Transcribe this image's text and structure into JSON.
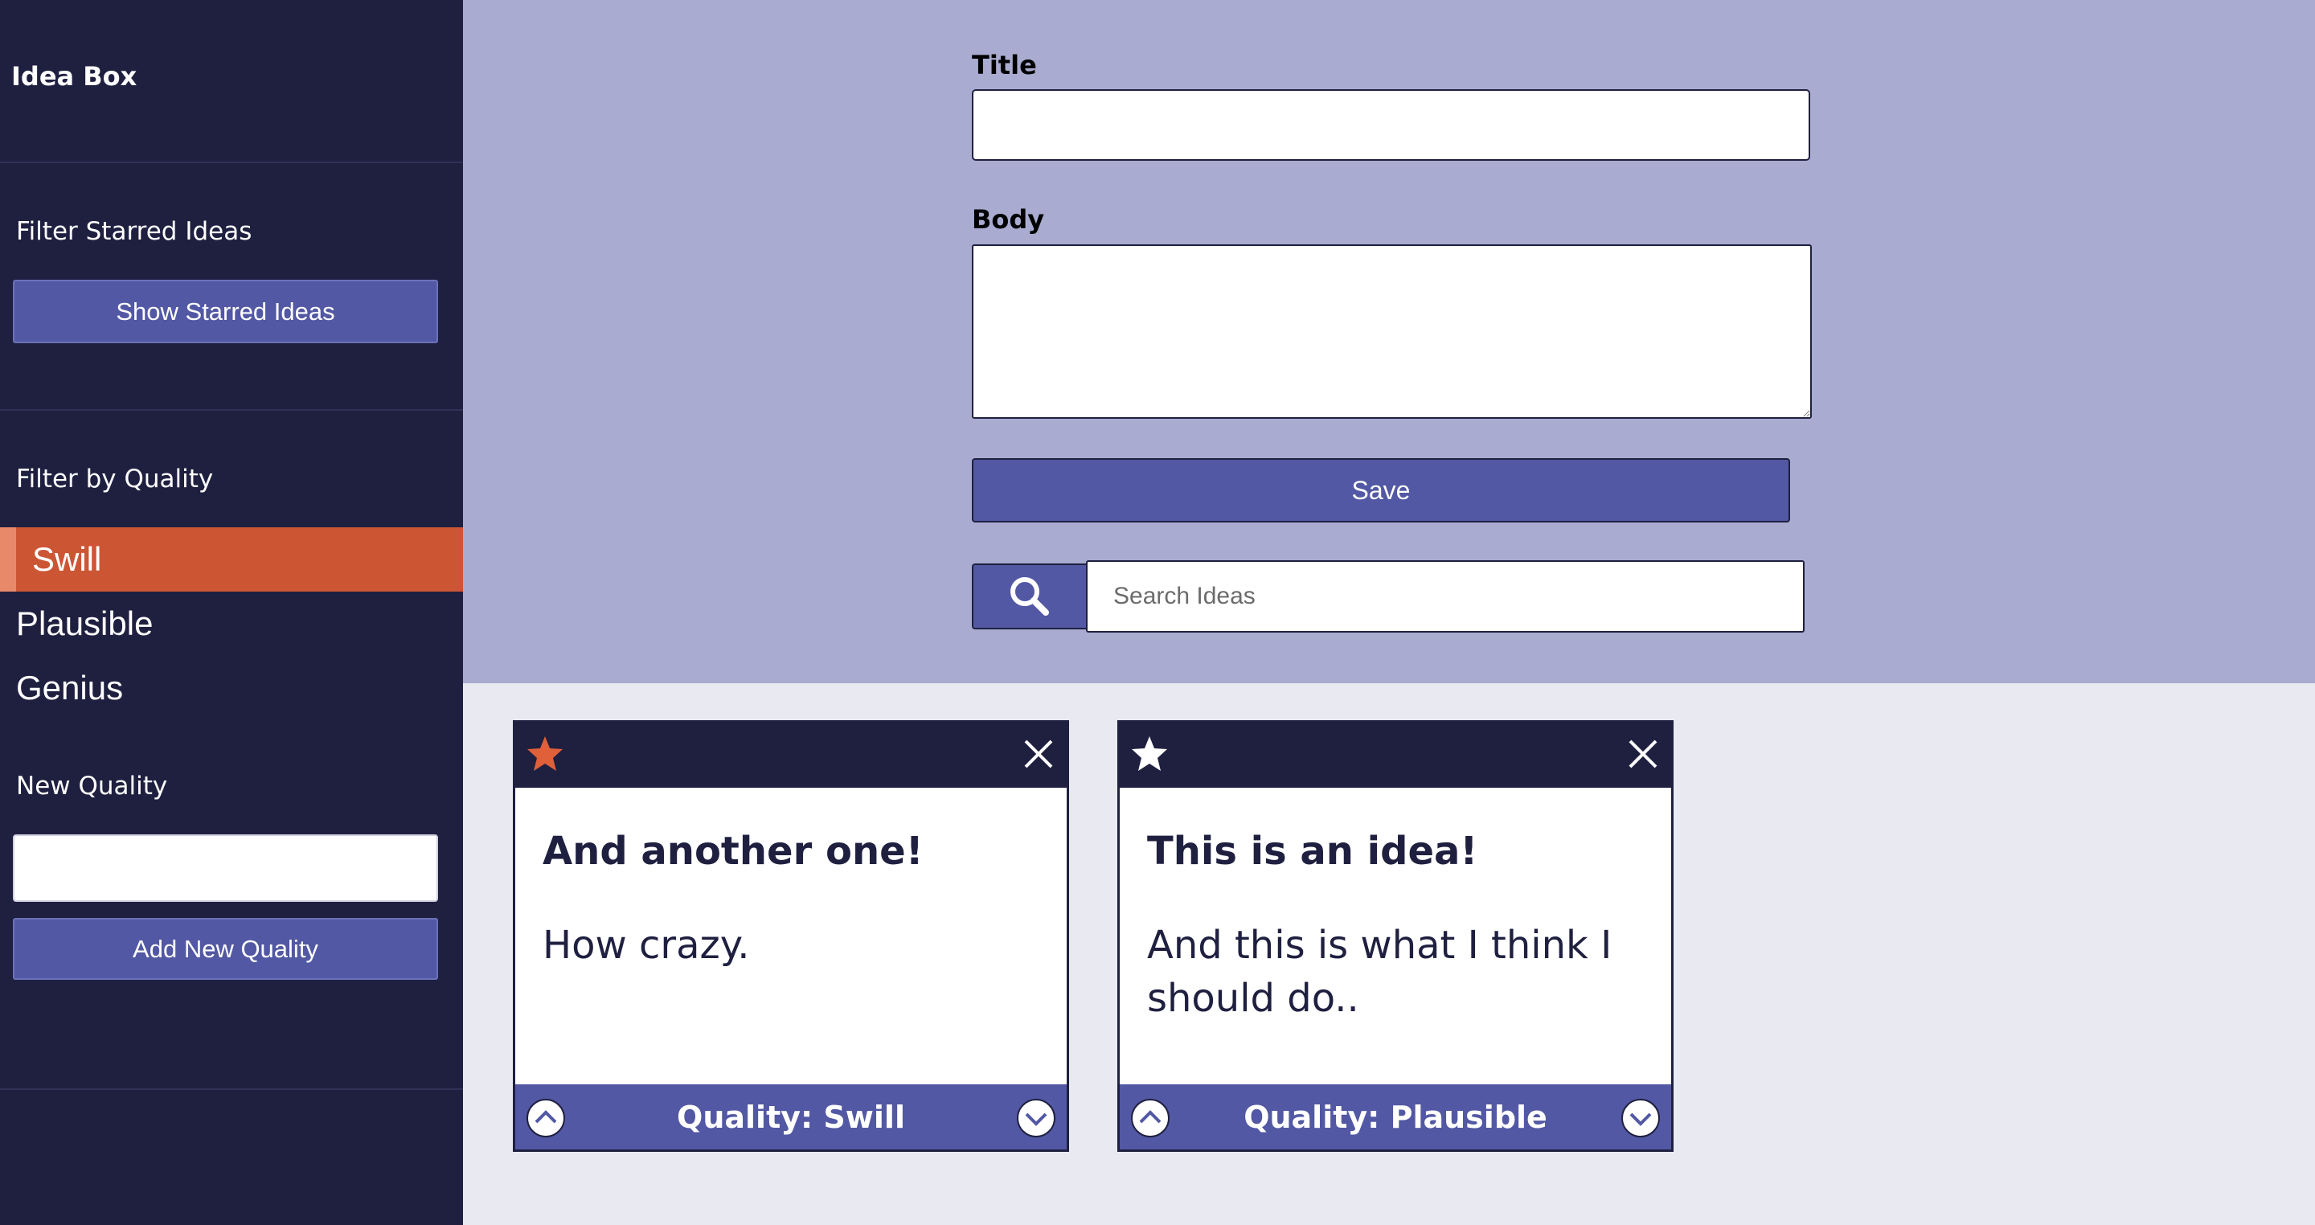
{
  "sidebar": {
    "brand": "Idea Box",
    "filter_starred_label": "Filter Starred Ideas",
    "show_starred_button": "Show Starred Ideas",
    "filter_quality_label": "Filter by Quality",
    "qualities": [
      {
        "label": "Swill",
        "active": true
      },
      {
        "label": "Plausible",
        "active": false
      },
      {
        "label": "Genius",
        "active": false
      }
    ],
    "new_quality_label": "New Quality",
    "new_quality_value": "",
    "add_quality_button": "Add New Quality"
  },
  "form": {
    "title_label": "Title",
    "title_value": "",
    "body_label": "Body",
    "body_value": "",
    "save_button": "Save",
    "search_placeholder": "Search Ideas",
    "search_icon": "search-icon"
  },
  "cards": [
    {
      "starred": true,
      "title": "And another one!",
      "body": "How crazy.",
      "quality": "Quality: Swill"
    },
    {
      "starred": false,
      "title": "This is an idea!",
      "body": "And this is what I think I should do..",
      "quality": "Quality: Plausible"
    }
  ],
  "colors": {
    "sidebar_bg": "#1f2040",
    "form_bg": "#a9acd0",
    "page_bg": "#e9e9f2",
    "accent": "#5258a3",
    "active_quality": "#cc5634",
    "star_active": "#e0603a"
  }
}
